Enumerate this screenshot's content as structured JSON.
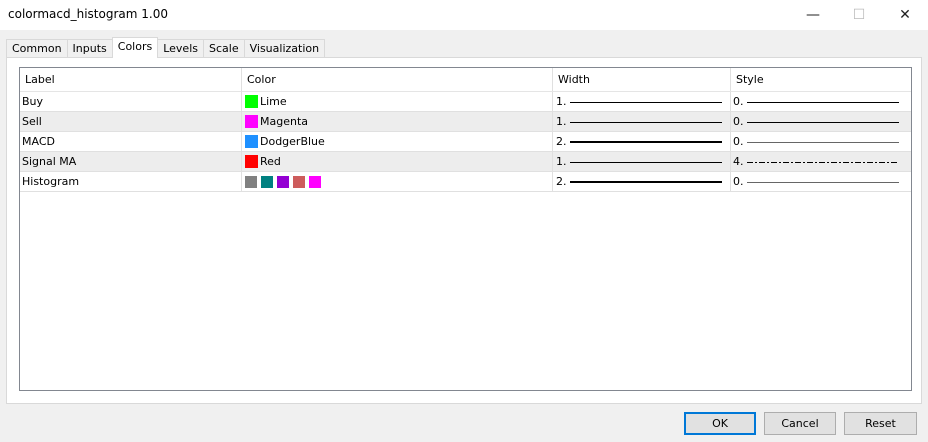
{
  "window": {
    "title": "colormacd_histogram 1.00",
    "min": "—",
    "max": "☐",
    "close": "✕"
  },
  "tabs": [
    {
      "label": "Common"
    },
    {
      "label": "Inputs"
    },
    {
      "label": "Colors"
    },
    {
      "label": "Levels"
    },
    {
      "label": "Scale"
    },
    {
      "label": "Visualization"
    }
  ],
  "active_tab": "Colors",
  "grid": {
    "headers": {
      "label": "Label",
      "color": "Color",
      "width": "Width",
      "style": "Style"
    },
    "rows": [
      {
        "label": "Buy",
        "color_name": "Lime",
        "color_hex": "#00ff00",
        "width": "1.",
        "style": "0."
      },
      {
        "label": "Sell",
        "color_name": "Magenta",
        "color_hex": "#ff00ff",
        "width": "1.",
        "style": "0."
      },
      {
        "label": "MACD",
        "color_name": "DodgerBlue",
        "color_hex": "#1e90ff",
        "width": "2.",
        "style": "0."
      },
      {
        "label": "Signal MA",
        "color_name": "Red",
        "color_hex": "#ff0000",
        "width": "1.",
        "style": "4."
      },
      {
        "label": "Histogram",
        "swatches": [
          "#808080",
          "#008080",
          "#9400d3",
          "#cd5c5c",
          "#ff00ff"
        ],
        "width": "2.",
        "style": "0."
      }
    ]
  },
  "buttons": {
    "ok": "OK",
    "cancel": "Cancel",
    "reset": "Reset"
  }
}
